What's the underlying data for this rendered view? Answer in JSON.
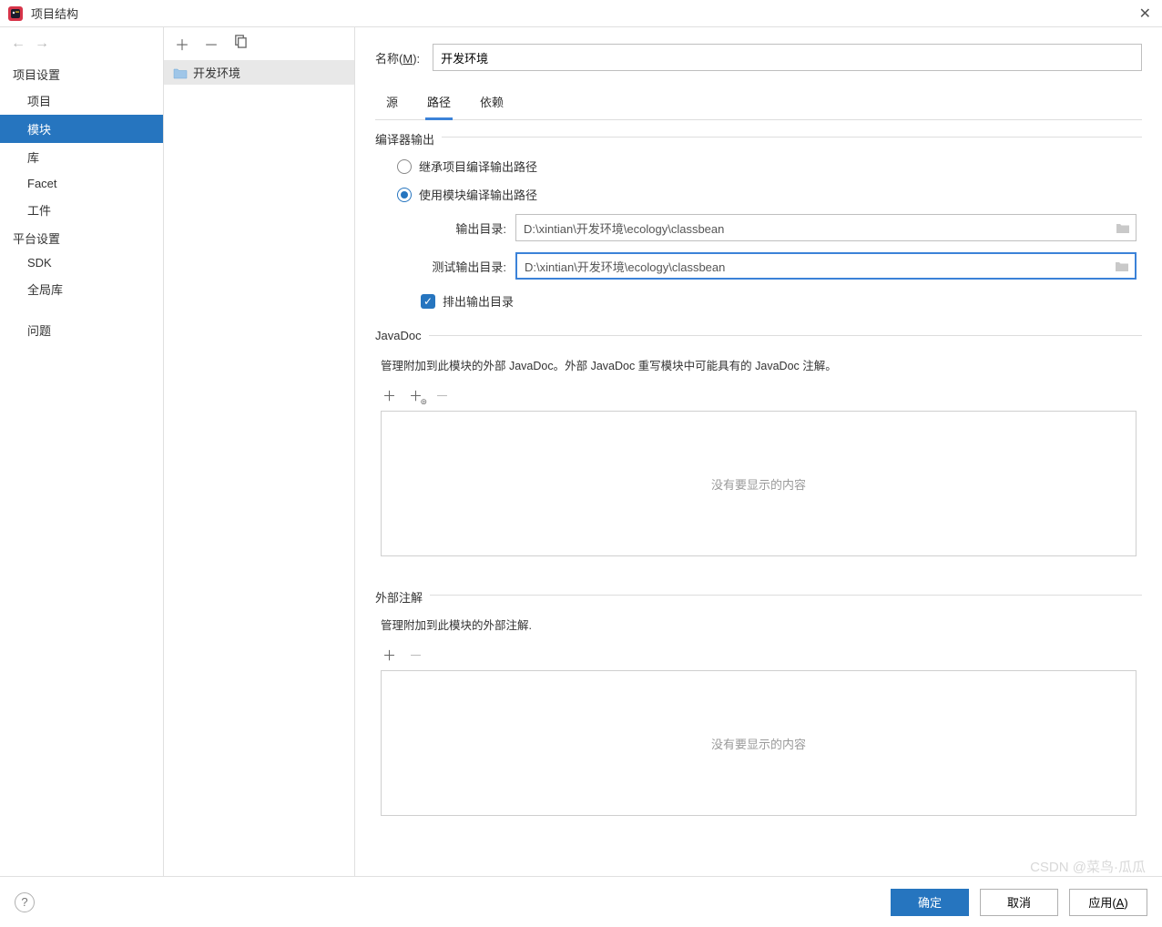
{
  "window": {
    "title": "项目结构"
  },
  "sidebar": {
    "groups": [
      {
        "label": "项目设置",
        "items": [
          {
            "label": "项目"
          },
          {
            "label": "模块",
            "selected": true
          },
          {
            "label": "库"
          },
          {
            "label": "Facet"
          },
          {
            "label": "工件"
          }
        ]
      },
      {
        "label": "平台设置",
        "items": [
          {
            "label": "SDK"
          },
          {
            "label": "全局库"
          }
        ]
      },
      {
        "label": "",
        "items": [
          {
            "label": "问题"
          }
        ]
      }
    ]
  },
  "moduleList": {
    "items": [
      {
        "label": "开发环境"
      }
    ]
  },
  "form": {
    "name_label_prefix": "名称(",
    "name_label_mn": "M",
    "name_label_suffix": "):",
    "name_value": "开发环境",
    "tabs": [
      {
        "label": "源"
      },
      {
        "label": "路径",
        "active": true
      },
      {
        "label": "依赖"
      }
    ],
    "compilerOutput": {
      "legend": "编译器输出",
      "radio_inherit": "继承项目编译输出路径",
      "radio_module": "使用模块编译输出路径",
      "out_label": "输出目录:",
      "out_value": "D:\\xintian\\开发环境\\ecology\\classbean",
      "test_label": "测试输出目录:",
      "test_value": "D:\\xintian\\开发环境\\ecology\\classbean",
      "exclude_label": "排出输出目录"
    },
    "javadoc": {
      "legend": "JavaDoc",
      "desc": "管理附加到此模块的外部 JavaDoc。外部 JavaDoc 重写模块中可能具有的 JavaDoc 注解。",
      "empty": "没有要显示的内容"
    },
    "annotations": {
      "legend": "外部注解",
      "desc": "管理附加到此模块的外部注解.",
      "empty": "没有要显示的内容"
    }
  },
  "footer": {
    "ok": "确定",
    "cancel": "取消",
    "apply_prefix": "应用(",
    "apply_mn": "A",
    "apply_suffix": ")"
  },
  "watermark": "CSDN @菜鸟·瓜瓜"
}
